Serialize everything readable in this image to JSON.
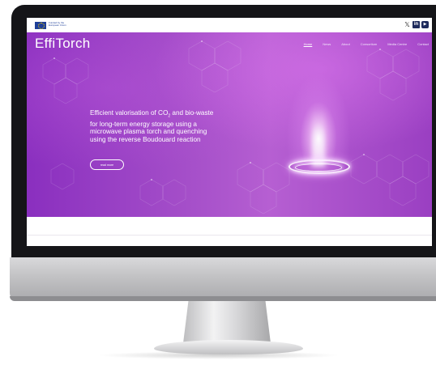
{
  "site": {
    "logo": "EffiTorch",
    "funding_text": "Funded by the European Union"
  },
  "nav": {
    "items": [
      "Home",
      "News",
      "About",
      "Consortium",
      "Media Centre",
      "Contact"
    ],
    "active": "Home"
  },
  "social": {
    "x_icon": "x-icon",
    "linkedin_icon": "linkedin-icon",
    "youtube_icon": "youtube-icon"
  },
  "hero": {
    "headline_part1": "Efficient valorisation of CO",
    "headline_sub": "2",
    "headline_part2": " and bio-waste for long-term energy storage using a microwave plasma torch and quenching using the reverse Boudouard reaction",
    "button_label": "read more"
  },
  "colors": {
    "hero_primary": "#8a2fbf",
    "hero_secondary": "#b65fd2",
    "brand_navy": "#1e2b5c"
  }
}
